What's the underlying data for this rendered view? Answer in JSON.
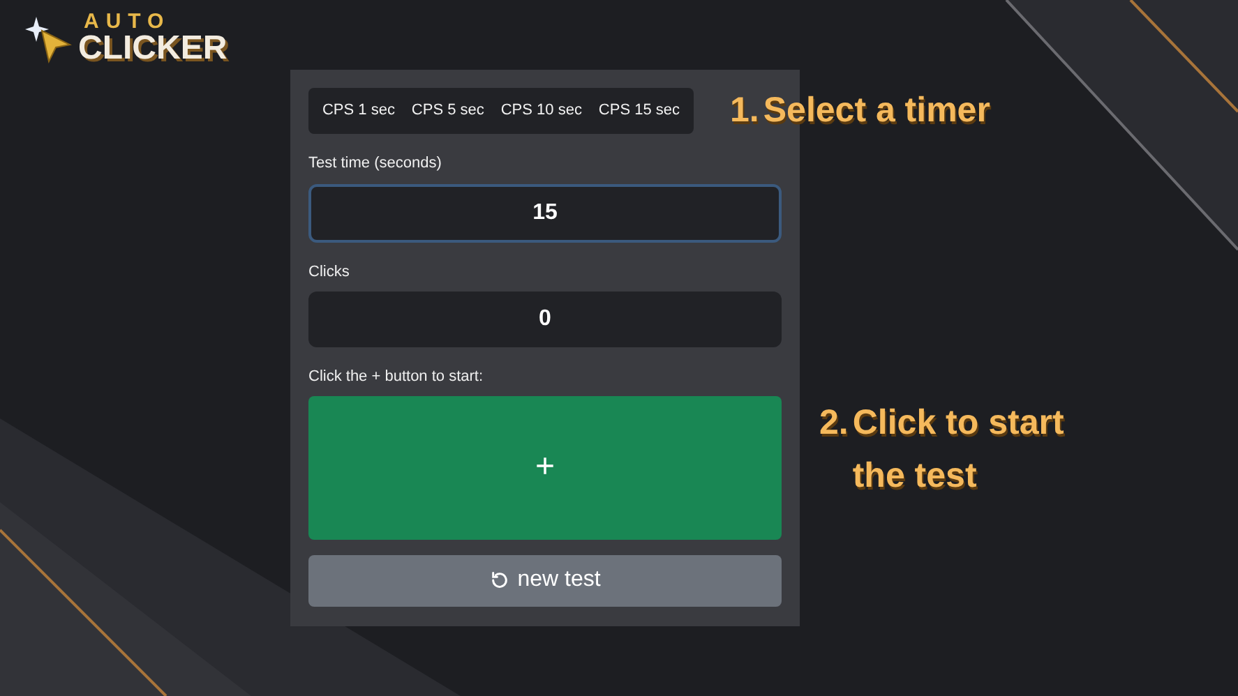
{
  "logo": {
    "top": "AUTO",
    "bottom": "CLICKER"
  },
  "timer_tabs": [
    {
      "label": "CPS 1 sec",
      "selected": false
    },
    {
      "label": "CPS 5 sec",
      "selected": false
    },
    {
      "label": "CPS 10 sec",
      "selected": false
    },
    {
      "label": "CPS 15 sec",
      "selected": false
    }
  ],
  "test_time": {
    "label": "Test time (seconds)",
    "value": "15",
    "focused": true
  },
  "clicks": {
    "label": "Clicks",
    "value": "0"
  },
  "click_area": {
    "label": "Click the + button to start:",
    "button": "+"
  },
  "new_test_button": {
    "label": "new test"
  },
  "steps": [
    {
      "number": "1.",
      "text": "Select a timer"
    },
    {
      "number": "2.",
      "text": "Click to start the test"
    }
  ]
}
